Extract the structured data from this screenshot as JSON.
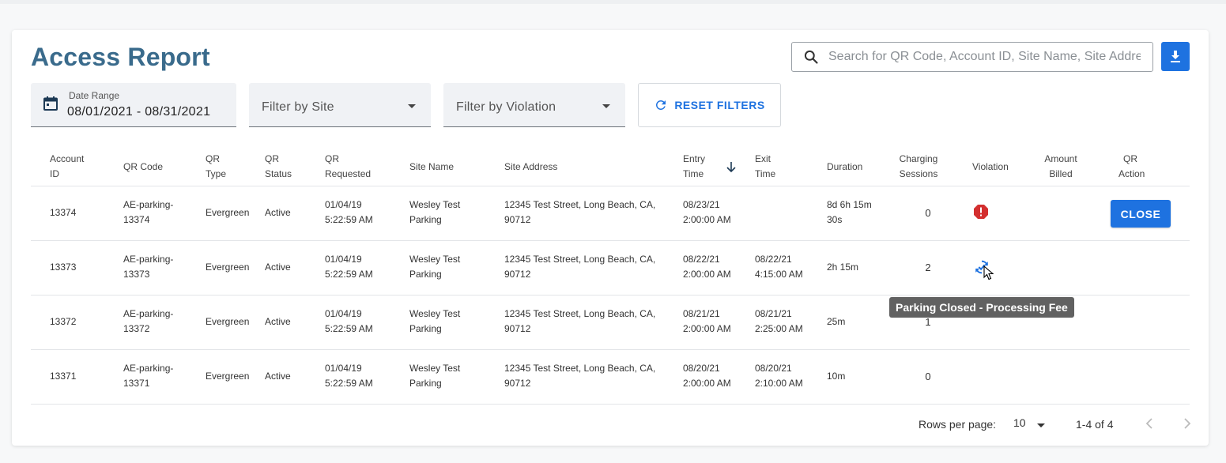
{
  "page": {
    "title": "Access Report",
    "search_placeholder": "Search for QR Code, Account ID, Site Name, Site Address"
  },
  "filters": {
    "date_label": "Date Range",
    "date_value": "08/01/2021 - 08/31/2021",
    "site_placeholder": "Filter by Site",
    "violation_placeholder": "Filter by Violation",
    "reset_label": "RESET FILTERS"
  },
  "table": {
    "columns": [
      [
        "Account",
        "ID"
      ],
      [
        "QR Code"
      ],
      [
        "QR",
        "Type"
      ],
      [
        "QR",
        "Status"
      ],
      [
        "QR",
        "Requested"
      ],
      [
        "Site Name"
      ],
      [
        "Site Address"
      ],
      [
        "Entry",
        "Time"
      ],
      [
        "Exit",
        "Time"
      ],
      [
        "Duration"
      ],
      [
        "Charging",
        "Sessions"
      ],
      [
        "Violation"
      ],
      [
        "Amount",
        "Billed"
      ],
      [
        "QR",
        "Action"
      ]
    ],
    "rows": [
      {
        "account_id": "13374",
        "qr_code": [
          "AE-parking-",
          "13374"
        ],
        "qr_type": "Evergreen",
        "qr_status": "Active",
        "qr_requested": [
          "01/04/19",
          "5:22:59 AM"
        ],
        "site_name": [
          "Wesley Test",
          "Parking"
        ],
        "site_address": [
          "12345 Test Street, Long Beach, CA,",
          "90712"
        ],
        "entry_time": [
          "08/23/21",
          "2:00:00 AM"
        ],
        "exit_time": [
          "",
          ""
        ],
        "duration": [
          "8d 6h 15m",
          "30s"
        ],
        "charging_sessions": "0",
        "action_label": "CLOSE"
      },
      {
        "account_id": "13373",
        "qr_code": [
          "AE-parking-",
          "13373"
        ],
        "qr_type": "Evergreen",
        "qr_status": "Active",
        "qr_requested": [
          "01/04/19",
          "5:22:59 AM"
        ],
        "site_name": [
          "Wesley Test",
          "Parking"
        ],
        "site_address": [
          "12345 Test Street, Long Beach, CA,",
          "90712"
        ],
        "entry_time": [
          "08/22/21",
          "2:00:00 AM"
        ],
        "exit_time": [
          "08/22/21",
          "4:15:00 AM"
        ],
        "duration": [
          "2h 15m"
        ],
        "charging_sessions": "2"
      },
      {
        "account_id": "13372",
        "qr_code": [
          "AE-parking-",
          "13372"
        ],
        "qr_type": "Evergreen",
        "qr_status": "Active",
        "qr_requested": [
          "01/04/19",
          "5:22:59 AM"
        ],
        "site_name": [
          "Wesley Test",
          "Parking"
        ],
        "site_address": [
          "12345 Test Street, Long Beach, CA,",
          "90712"
        ],
        "entry_time": [
          "08/21/21",
          "2:00:00 AM"
        ],
        "exit_time": [
          "08/21/21",
          "2:25:00 AM"
        ],
        "duration": [
          "25m"
        ],
        "charging_sessions": "1"
      },
      {
        "account_id": "13371",
        "qr_code": [
          "AE-parking-",
          "13371"
        ],
        "qr_type": "Evergreen",
        "qr_status": "Active",
        "qr_requested": [
          "01/04/19",
          "5:22:59 AM"
        ],
        "site_name": [
          "Wesley Test",
          "Parking"
        ],
        "site_address": [
          "12345 Test Street, Long Beach, CA,",
          "90712"
        ],
        "entry_time": [
          "08/20/21",
          "2:00:00 AM"
        ],
        "exit_time": [
          "08/20/21",
          "2:10:00 AM"
        ],
        "duration": [
          "10m"
        ],
        "charging_sessions": "0"
      }
    ]
  },
  "tooltip": "Parking Closed - Processing Fee",
  "pagination": {
    "rows_per_page_label": "Rows per page:",
    "rows_per_page_value": "10",
    "range": "1-4 of 4"
  },
  "colors": {
    "accent": "#1e72e0",
    "title": "#3a6b8c",
    "violation": "#d32f2f"
  }
}
